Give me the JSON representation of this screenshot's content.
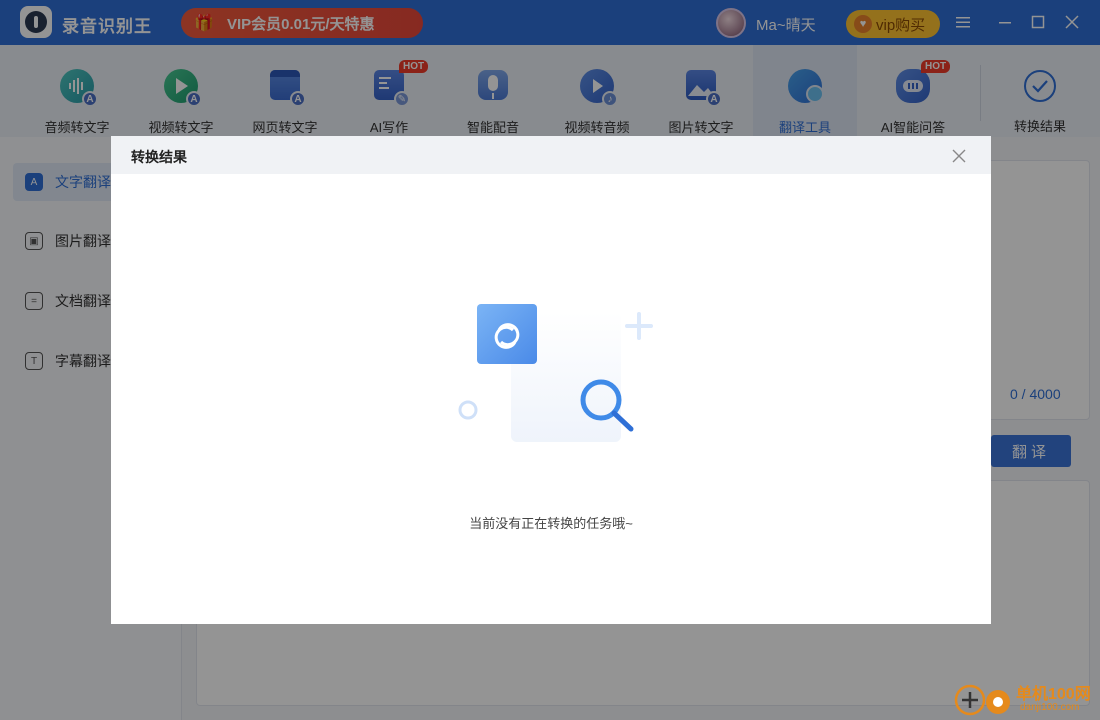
{
  "app": {
    "title": "录音识别王",
    "vip_promo": "VIP会员0.01元/天特惠",
    "username": "Ma~晴天",
    "vip_buy": "vip购买"
  },
  "window_controls": {
    "menu_icon": "menu-icon",
    "minimize_icon": "minimize-icon",
    "maximize_icon": "maximize-icon",
    "close_icon": "close-icon"
  },
  "toolbar": {
    "items": [
      {
        "label": "音频转文字",
        "icon": "audio-to-text-icon",
        "hot": ""
      },
      {
        "label": "视频转文字",
        "icon": "video-to-text-icon",
        "hot": ""
      },
      {
        "label": "网页转文字",
        "icon": "webpage-to-text-icon",
        "hot": ""
      },
      {
        "label": "AI写作",
        "icon": "ai-writing-icon",
        "hot": "HOT"
      },
      {
        "label": "智能配音",
        "icon": "smart-dubbing-icon",
        "hot": ""
      },
      {
        "label": "视频转音频",
        "icon": "video-to-audio-icon",
        "hot": ""
      },
      {
        "label": "图片转文字",
        "icon": "image-to-text-icon",
        "hot": ""
      },
      {
        "label": "翻译工具",
        "icon": "translate-tool-icon",
        "hot": ""
      },
      {
        "label": "AI智能问答",
        "icon": "ai-qa-icon",
        "hot": "HOT"
      }
    ],
    "result_label": "转换结果",
    "active_index": 7
  },
  "sidebar": {
    "items": [
      {
        "label": "文字翻译",
        "glyph": "A"
      },
      {
        "label": "图片翻译",
        "glyph": "▣"
      },
      {
        "label": "文档翻译",
        "glyph": "="
      },
      {
        "label": "字幕翻译",
        "glyph": "T"
      }
    ],
    "active_index": 0
  },
  "main": {
    "char_count": "0 / 4000",
    "translate_button": "翻译"
  },
  "modal": {
    "title": "转换结果",
    "empty_message": "当前没有正在转换的任务哦~"
  },
  "watermark": {
    "site_name": "单机100网",
    "site_url": "danji100.com"
  },
  "colors": {
    "brand_blue": "#2f6fd6",
    "hot_red": "#f03b2a",
    "vip_gold": "#ffc331"
  }
}
